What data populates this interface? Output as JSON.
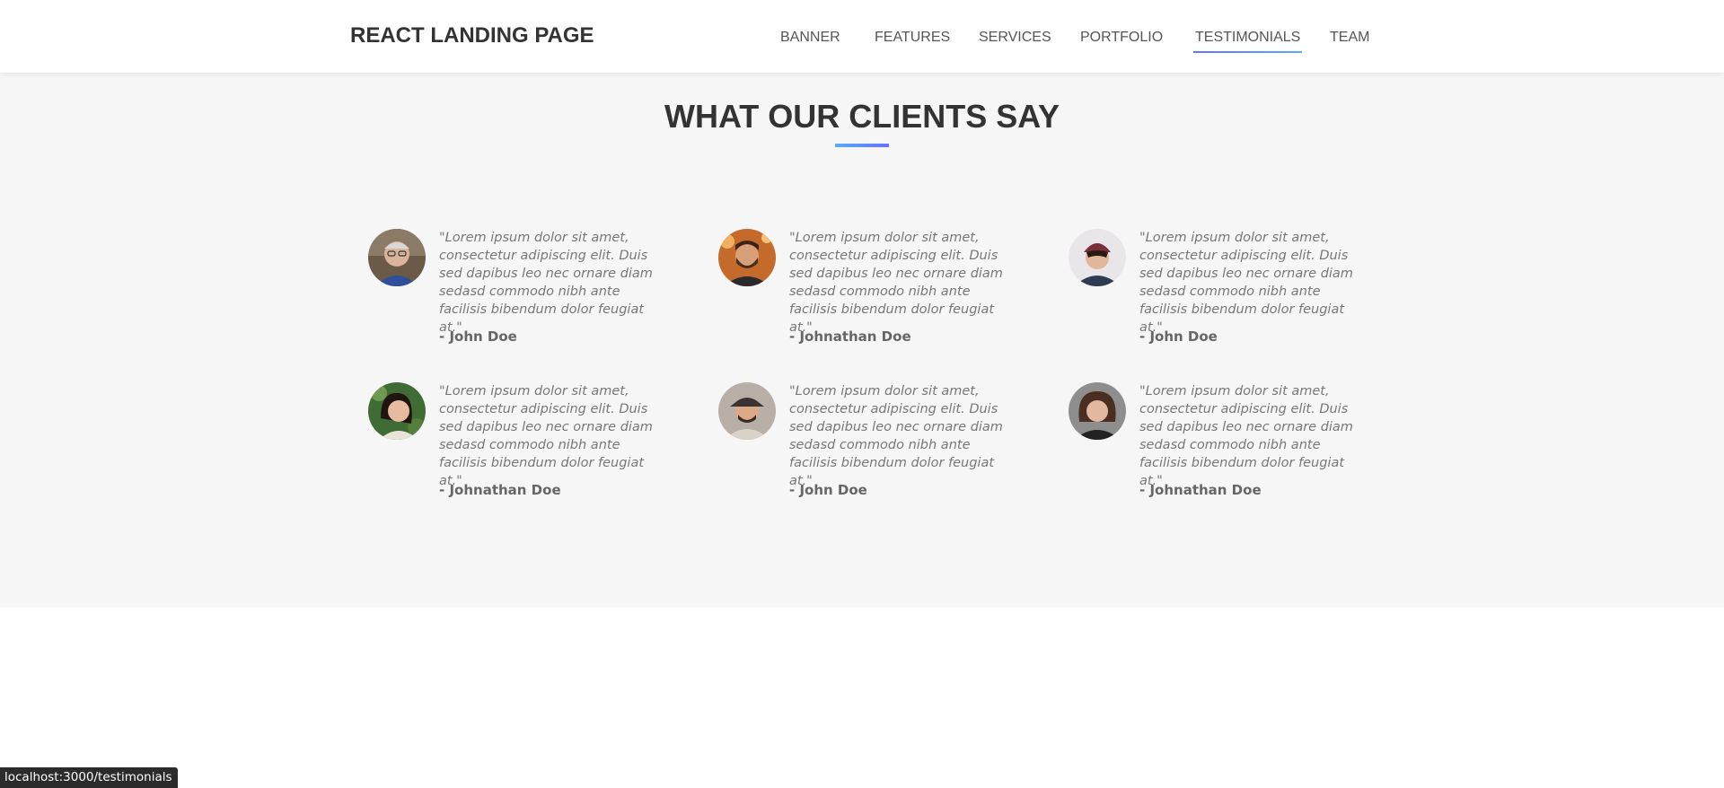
{
  "brand": "REACT LANDING PAGE",
  "nav": [
    {
      "label": "BANNER"
    },
    {
      "label": "FEATURES"
    },
    {
      "label": "SERVICES"
    },
    {
      "label": "PORTFOLIO"
    },
    {
      "label": "TESTIMONIALS",
      "active": true
    },
    {
      "label": "TEAM"
    }
  ],
  "section": {
    "title": "WHAT OUR CLIENTS SAY",
    "accent_colors": [
      "#5ca9fb",
      "#6372ff"
    ]
  },
  "testimonials": [
    {
      "quote": "\"Lorem ipsum dolor sit amet, consectetur adipiscing elit. Duis sed dapibus leo nec ornare diam sedasd commodo nibh ante facilisis bibendum dolor feugiat at.\"",
      "author": "- John Doe",
      "avatar_icon": "older-man-glasses-avatar"
    },
    {
      "quote": "\"Lorem ipsum dolor sit amet, consectetur adipiscing elit. Duis sed dapibus leo nec ornare diam sedasd commodo nibh ante facilisis bibendum dolor feugiat at.\"",
      "author": "- Johnathan Doe",
      "avatar_icon": "bearded-man-avatar"
    },
    {
      "quote": "\"Lorem ipsum dolor sit amet, consectetur adipiscing elit. Duis sed dapibus leo nec ornare diam sedasd commodo nibh ante facilisis bibendum dolor feugiat at.\"",
      "author": "- John Doe",
      "avatar_icon": "young-man-beanie-avatar"
    },
    {
      "quote": "\"Lorem ipsum dolor sit amet, consectetur adipiscing elit. Duis sed dapibus leo nec ornare diam sedasd commodo nibh ante facilisis bibendum dolor feugiat at.\"",
      "author": "- Johnathan Doe",
      "avatar_icon": "woman-smiling-avatar"
    },
    {
      "quote": "\"Lorem ipsum dolor sit amet, consectetur adipiscing elit. Duis sed dapibus leo nec ornare diam sedasd commodo nibh ante facilisis bibendum dolor feugiat at.\"",
      "author": "- John Doe",
      "avatar_icon": "man-flat-cap-avatar"
    },
    {
      "quote": "\"Lorem ipsum dolor sit amet, consectetur adipiscing elit. Duis sed dapibus leo nec ornare diam sedasd commodo nibh ante facilisis bibendum dolor feugiat at.\"",
      "author": "- Johnathan Doe",
      "avatar_icon": "woman-curly-hair-avatar"
    }
  ],
  "status_url": "localhost:3000/testimonials"
}
